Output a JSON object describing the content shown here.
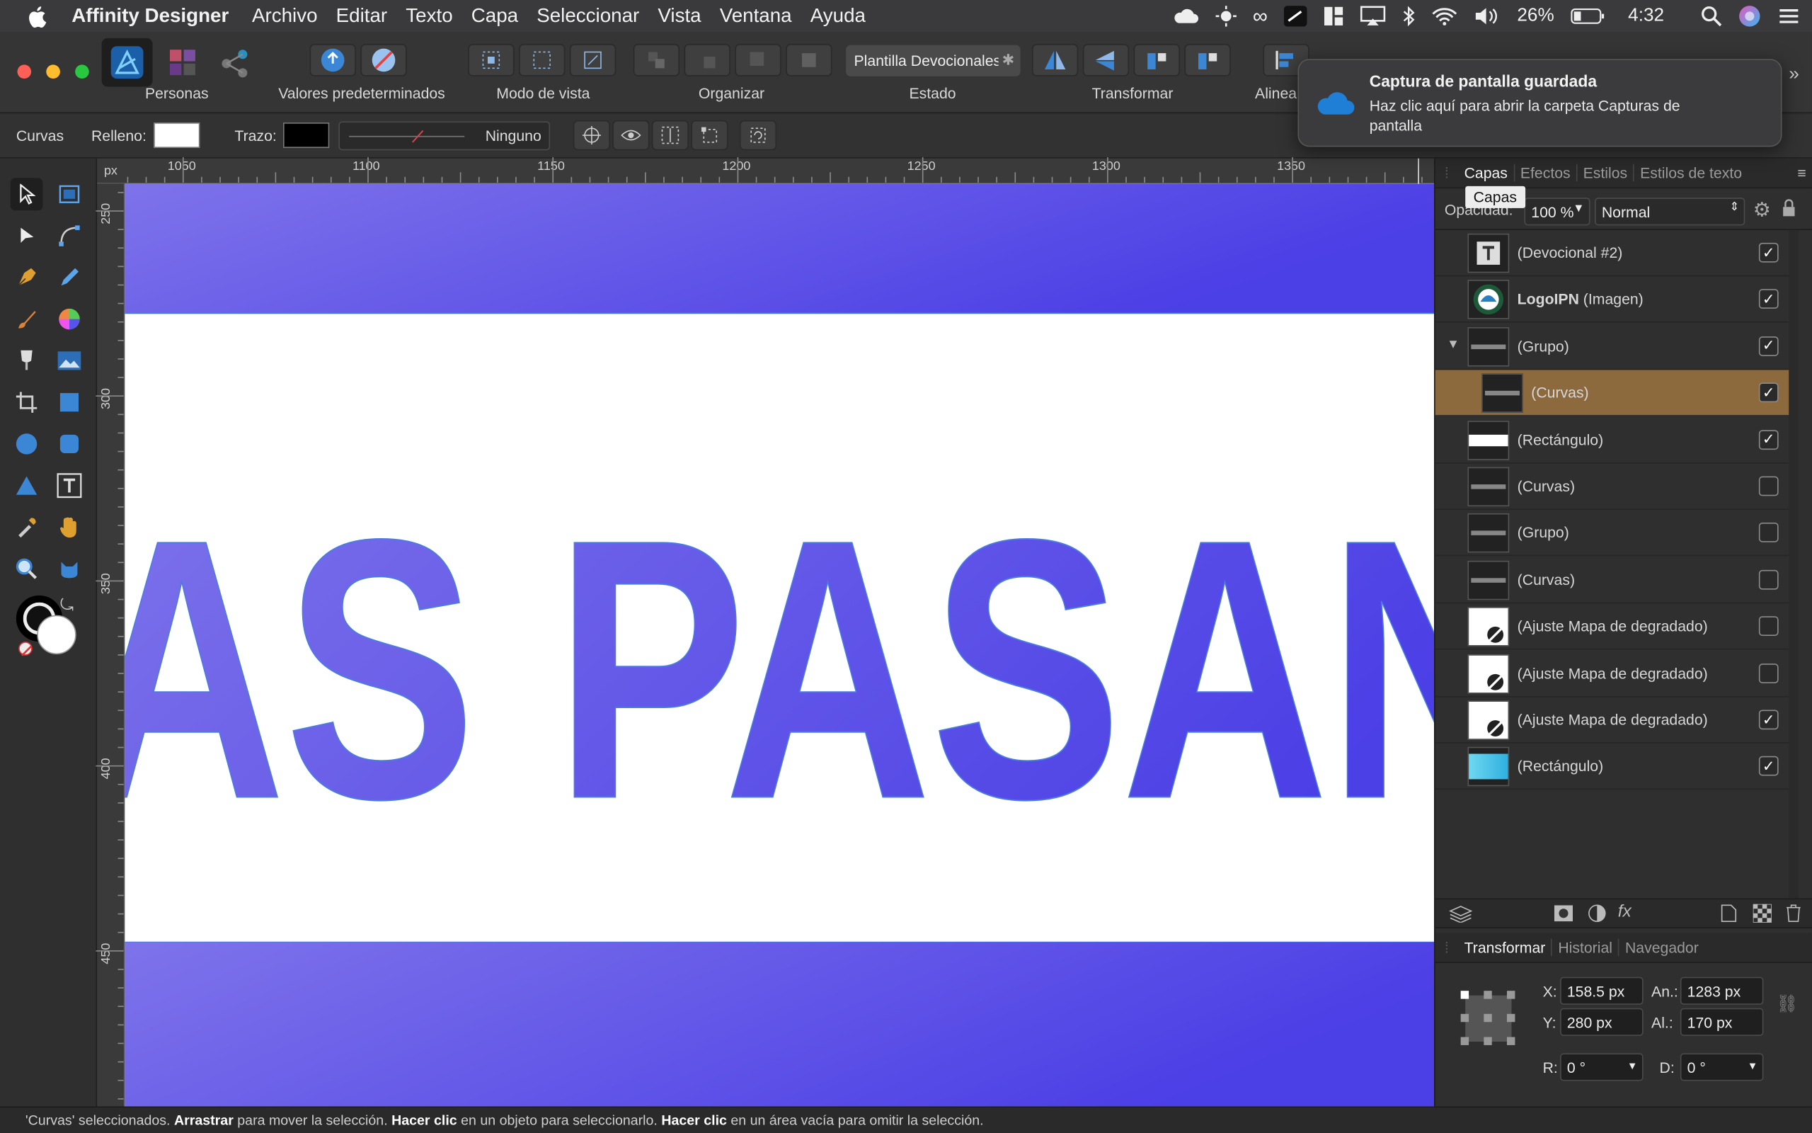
{
  "menubar": {
    "app": "Affinity Designer",
    "items": [
      "Archivo",
      "Editar",
      "Texto",
      "Capa",
      "Seleccionar",
      "Vista",
      "Ventana",
      "Ayuda"
    ],
    "battery": "26%",
    "time": "4:32"
  },
  "toolbar": {
    "personas": "Personas",
    "defaults": "Valores predeterminados",
    "view_mode": "Modo de vista",
    "arrange": "Organizar",
    "state_value": "Plantilla Devocionales",
    "state": "Estado",
    "transform": "Transformar",
    "align": "Alinea"
  },
  "context": {
    "tool": "Curvas",
    "fill": "Relleno:",
    "stroke": "Trazo:",
    "stroke_style": "Ninguno",
    "fill_color": "#ffffff",
    "stroke_color": "#000000"
  },
  "ruler": {
    "unit": "px",
    "h_labels": [
      "1050",
      "1100",
      "1150",
      "1200",
      "1250",
      "1300",
      "1350"
    ],
    "v_labels": [
      "250",
      "300",
      "350",
      "400",
      "450"
    ]
  },
  "canvas": {
    "text": "AS PASAN",
    "gradient_start": "#7b6fe9",
    "gradient_end": "#4a3ee6"
  },
  "layers_panel": {
    "tabs": [
      "Capas",
      "Efectos",
      "Estilos",
      "Estilos de texto"
    ],
    "tooltip": "Capas",
    "opacity_label": "Opacidad:",
    "opacity": "100 %",
    "blend": "Normal",
    "layers": [
      {
        "name": "(Devocional #2)",
        "bold": "",
        "checked": true,
        "thumb": "text-icon"
      },
      {
        "name": " (Imagen)",
        "bold": "LogoIPN",
        "checked": true,
        "thumb": "logo"
      },
      {
        "name": "(Grupo)",
        "bold": "",
        "checked": true,
        "thumb": "dark"
      },
      {
        "name": "(Curvas)",
        "bold": "",
        "checked": true,
        "thumb": "dark",
        "selected": true
      },
      {
        "name": "(Rectángulo)",
        "bold": "",
        "checked": true,
        "thumb": "white-bar"
      },
      {
        "name": "(Curvas)",
        "bold": "",
        "checked": false,
        "thumb": "dark"
      },
      {
        "name": "(Grupo)",
        "bold": "",
        "checked": false,
        "thumb": "dark"
      },
      {
        "name": "(Curvas)",
        "bold": "",
        "checked": false,
        "thumb": "dark"
      },
      {
        "name": "(Ajuste Mapa de degradado)",
        "bold": "",
        "checked": false,
        "thumb": "adjust"
      },
      {
        "name": "(Ajuste Mapa de degradado)",
        "bold": "",
        "checked": false,
        "thumb": "adjust"
      },
      {
        "name": "(Ajuste Mapa de degradado)",
        "bold": "",
        "checked": true,
        "thumb": "adjust"
      },
      {
        "name": "(Rectángulo)",
        "bold": "",
        "checked": true,
        "thumb": "cyan"
      }
    ]
  },
  "transform_panel": {
    "tabs": [
      "Transformar",
      "Historial",
      "Navegador"
    ],
    "x_label": "X:",
    "x": "158.5 px",
    "y_label": "Y:",
    "y": "280 px",
    "w_label": "An.:",
    "w": "1283 px",
    "h_label": "Al.:",
    "h": "170 px",
    "r_label": "R:",
    "r": "0 °",
    "d_label": "D:",
    "d": "0 °"
  },
  "notification": {
    "title": "Captura de pantalla guardada",
    "body": "Haz clic aquí para abrir la carpeta Capturas de pantalla"
  },
  "status": {
    "p1": "'Curvas' seleccionados. ",
    "b1": "Arrastrar",
    "p2": " para mover la selección. ",
    "b2": "Hacer clic",
    "p3": " en un objeto para seleccionarlo. ",
    "b3": "Hacer clic",
    "p4": " en un área vacía para omitir la selección."
  }
}
